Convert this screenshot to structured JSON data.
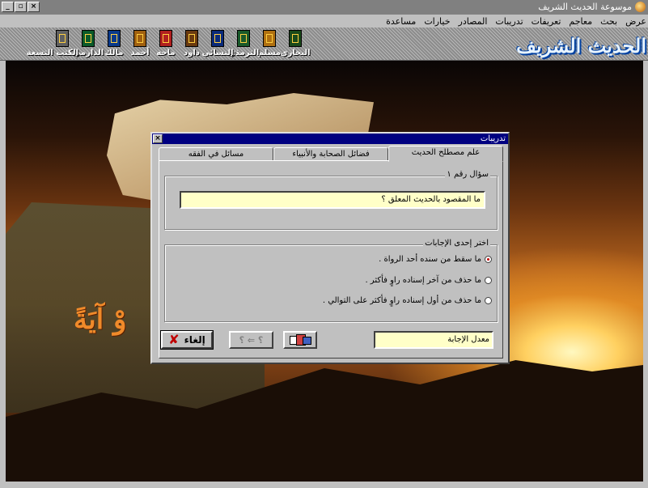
{
  "window": {
    "title": "موسوعة الحديث الشريف",
    "buttons": [
      "_",
      "▫",
      "×"
    ]
  },
  "menu": [
    "عرض",
    "بحث",
    "معاجم",
    "تعريفات",
    "تدريبات",
    "المصادر",
    "خيارات",
    "مساعدة"
  ],
  "toolbar": {
    "books": [
      {
        "label": "البخاري",
        "color": "#1a4a1a"
      },
      {
        "label": "مسلم",
        "color": "#b07010"
      },
      {
        "label": "الترمذي",
        "color": "#1a5a2a"
      },
      {
        "label": "النسائي",
        "color": "#0a2a7a"
      },
      {
        "label": "داود",
        "color": "#6a3a10"
      },
      {
        "label": "ماجه",
        "color": "#b02020"
      },
      {
        "label": "أحمد",
        "color": "#a06010"
      },
      {
        "label": "مالك",
        "color": "#0a3a8a"
      },
      {
        "label": "الدارمي",
        "color": "#0a5a2a"
      },
      {
        "label": "الكتب التسعة",
        "color": "#606060"
      }
    ],
    "logo": "الحديث الشريف"
  },
  "background": {
    "calligraphy": "وْ آيَةً"
  },
  "dialog": {
    "title": "تدريبات",
    "close": "×",
    "tabs": [
      "علم مصطلح الحديث",
      "فضائل الصحابة والأنبياء",
      "مسائل في الفقه"
    ],
    "active_tab": 0,
    "question_legend": "سؤال رقم ١",
    "question": "ما المقصود بالحديث المعلق ؟",
    "answers_legend": "اختر إحدى الإجابات",
    "options": [
      {
        "text": "ما سقط من سنده أحد الرواة .",
        "selected": true
      },
      {
        "text": "ما حذف من آخر إسناده راوٍ فأكثر .",
        "selected": false
      },
      {
        "text": "ما حذف من أول إسناده راوٍ فأكثر على التوالي .",
        "selected": false
      }
    ],
    "rate_label": "معدل الإجابة",
    "cancel_label": "إلغاء",
    "cancel_icon": "✘",
    "nav_label": "؟ ⇐ ؟"
  }
}
